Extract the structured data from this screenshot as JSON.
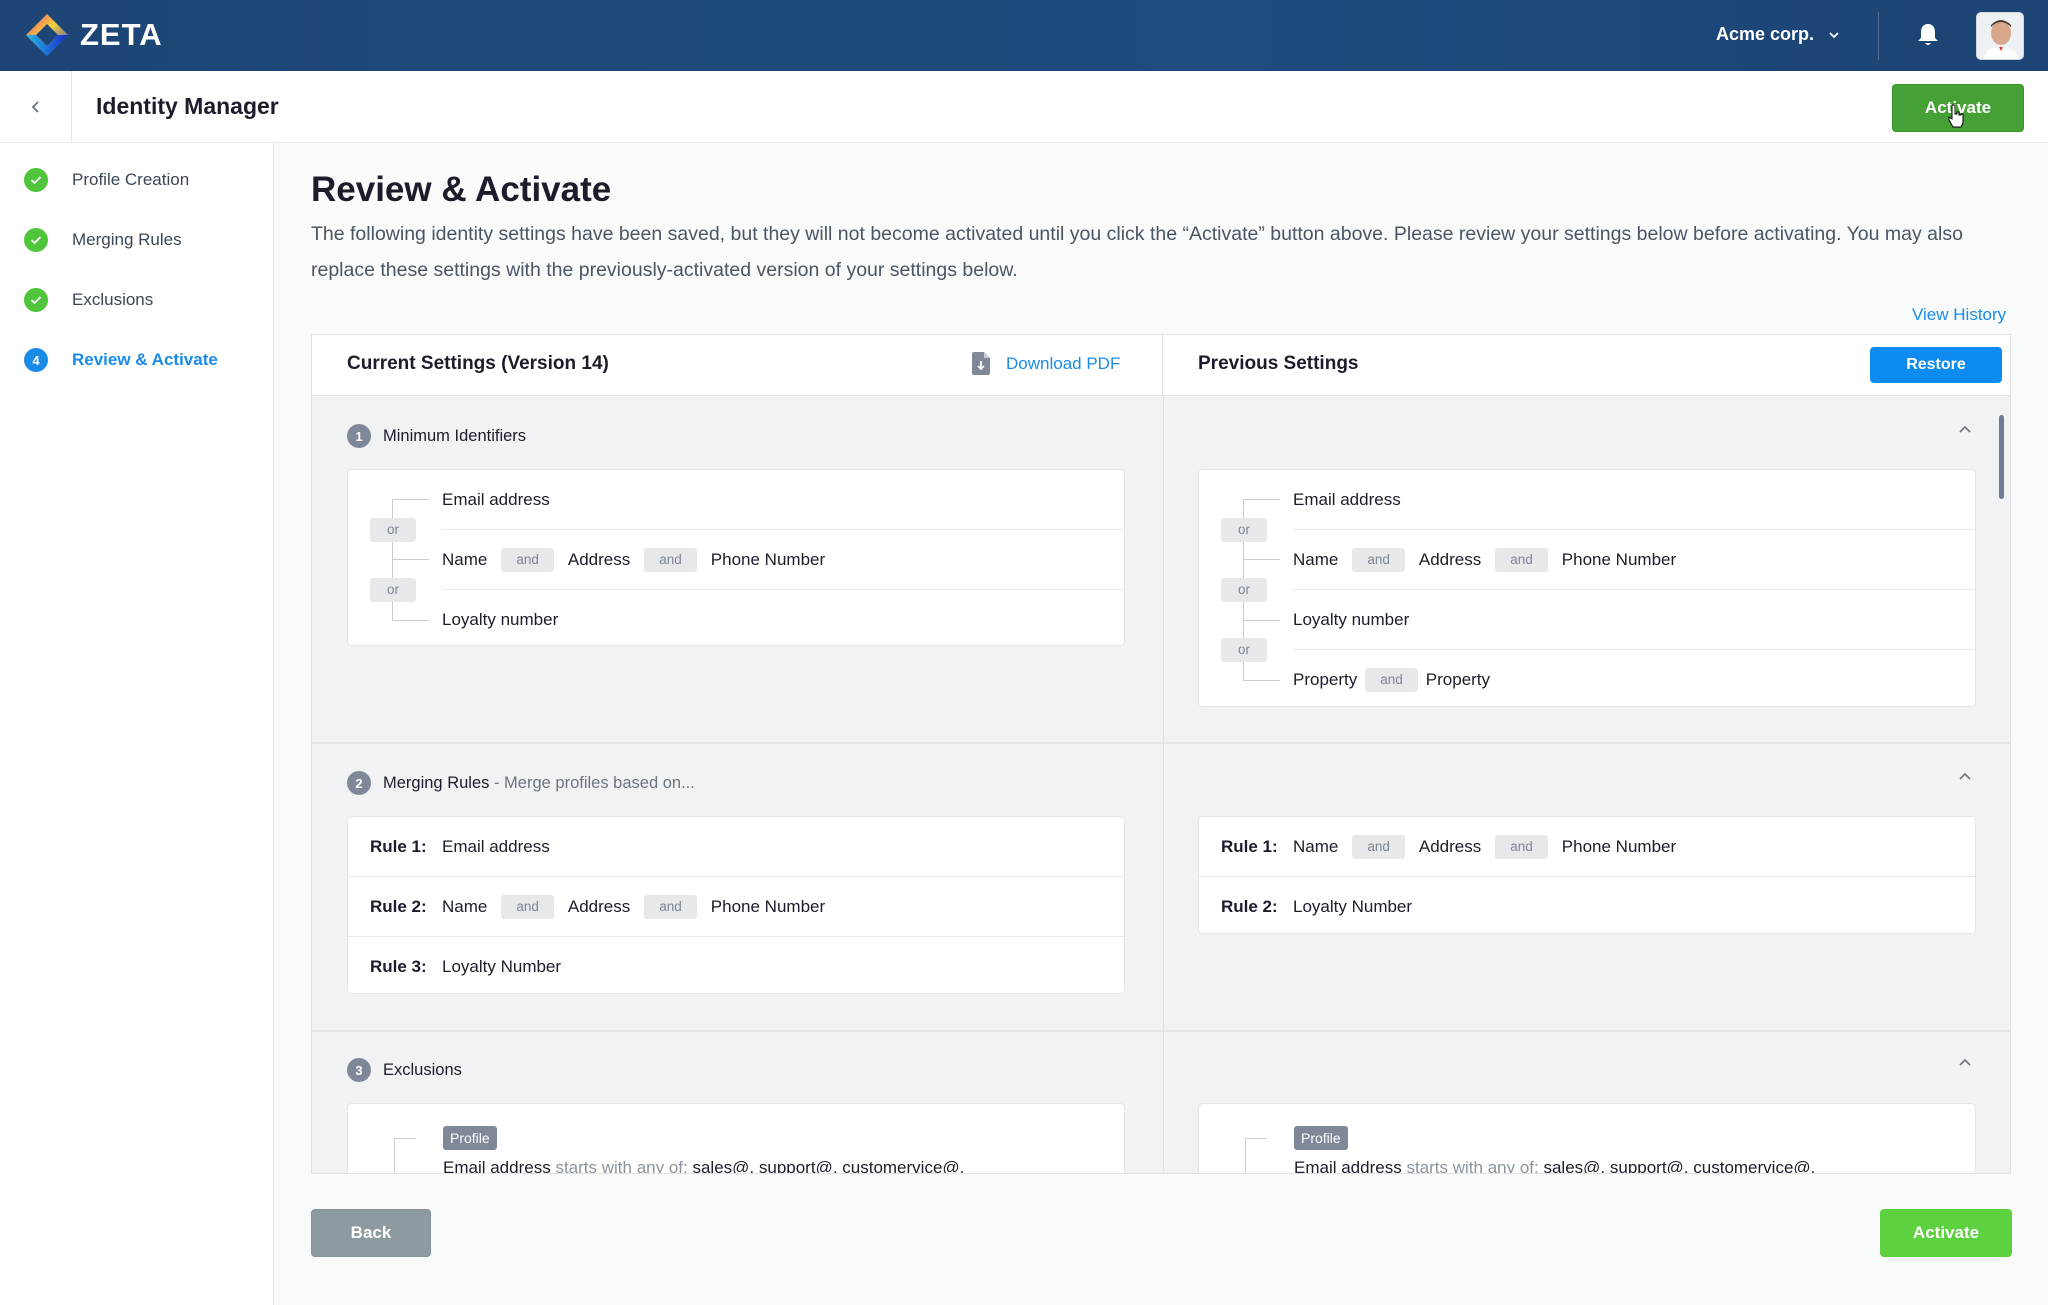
{
  "topbar": {
    "brand": "ZETA",
    "org_name": "Acme corp.",
    "icons": {
      "logo": "zeta-diamond-logo",
      "org_dropdown": "chevron-down-icon",
      "notifications": "bell-icon",
      "avatar": "user-avatar"
    }
  },
  "subheader": {
    "back_icon": "chevron-left-icon",
    "title": "Identity Manager",
    "activate_label": "Activate"
  },
  "sidebar": {
    "steps": [
      {
        "label": "Profile Creation",
        "state": "complete",
        "icon": "check-icon"
      },
      {
        "label": "Merging Rules",
        "state": "complete",
        "icon": "check-icon"
      },
      {
        "label": "Exclusions",
        "state": "complete",
        "icon": "check-icon"
      },
      {
        "label": "Review & Activate",
        "state": "active",
        "number": "4"
      }
    ]
  },
  "main": {
    "title": "Review & Activate",
    "description": "The following identity settings have been saved, but they will not become activated until you click the “Activate” button above.  Please review your settings below before activating. You may also replace these settings with the previously-activated version of your settings below.",
    "view_history": "View History",
    "current": {
      "title": "Current Settings (Version 14)",
      "download_label": "Download PDF",
      "download_icon": "file-download-icon"
    },
    "previous": {
      "title": "Previous Settings",
      "restore_label": "Restore"
    },
    "connectors": {
      "or": "or",
      "and": "and"
    },
    "sections": [
      {
        "number": "1",
        "title": "Minimum Identifiers",
        "subtitle": "",
        "current": [
          [
            "Email address"
          ],
          [
            "Name",
            "Address",
            "Phone Number"
          ],
          [
            "Loyalty number"
          ]
        ],
        "previous": [
          [
            "Email address"
          ],
          [
            "Name",
            "Address",
            "Phone Number"
          ],
          [
            "Loyalty number"
          ],
          [
            "Property",
            "Property"
          ]
        ]
      },
      {
        "number": "2",
        "title": "Merging Rules",
        "subtitle": " - Merge profiles based on...",
        "current": [
          {
            "label": "Rule 1:",
            "terms": [
              "Email address"
            ]
          },
          {
            "label": "Rule 2:",
            "terms": [
              "Name",
              "Address",
              "Phone Number"
            ]
          },
          {
            "label": "Rule 3:",
            "terms": [
              "Loyalty Number"
            ]
          }
        ],
        "previous": [
          {
            "label": "Rule 1:",
            "terms": [
              "Name",
              "Address",
              "Phone Number"
            ]
          },
          {
            "label": "Rule 2:",
            "terms": [
              "Loyalty Number"
            ]
          }
        ]
      },
      {
        "number": "3",
        "title": "Exclusions",
        "subtitle": "",
        "current": {
          "tag": "Profile",
          "field": "Email address",
          "operator": "starts with any of:",
          "values": "sales@, support@, customervice@,"
        },
        "previous": {
          "tag": "Profile",
          "field": "Email address",
          "operator": "starts with any of:",
          "values": "sales@, support@, customervice@,"
        }
      }
    ]
  },
  "footer": {
    "back_label": "Back",
    "activate_label": "Activate"
  },
  "colors": {
    "topbar": "#1f4b7e",
    "primary_blue": "#1a8ce8",
    "restore_blue": "#0d8bf0",
    "success_green": "#4fc53c",
    "activate_top": "#45a035",
    "activate_bottom": "#5dd13f",
    "back_gray": "#8d9ba0"
  }
}
